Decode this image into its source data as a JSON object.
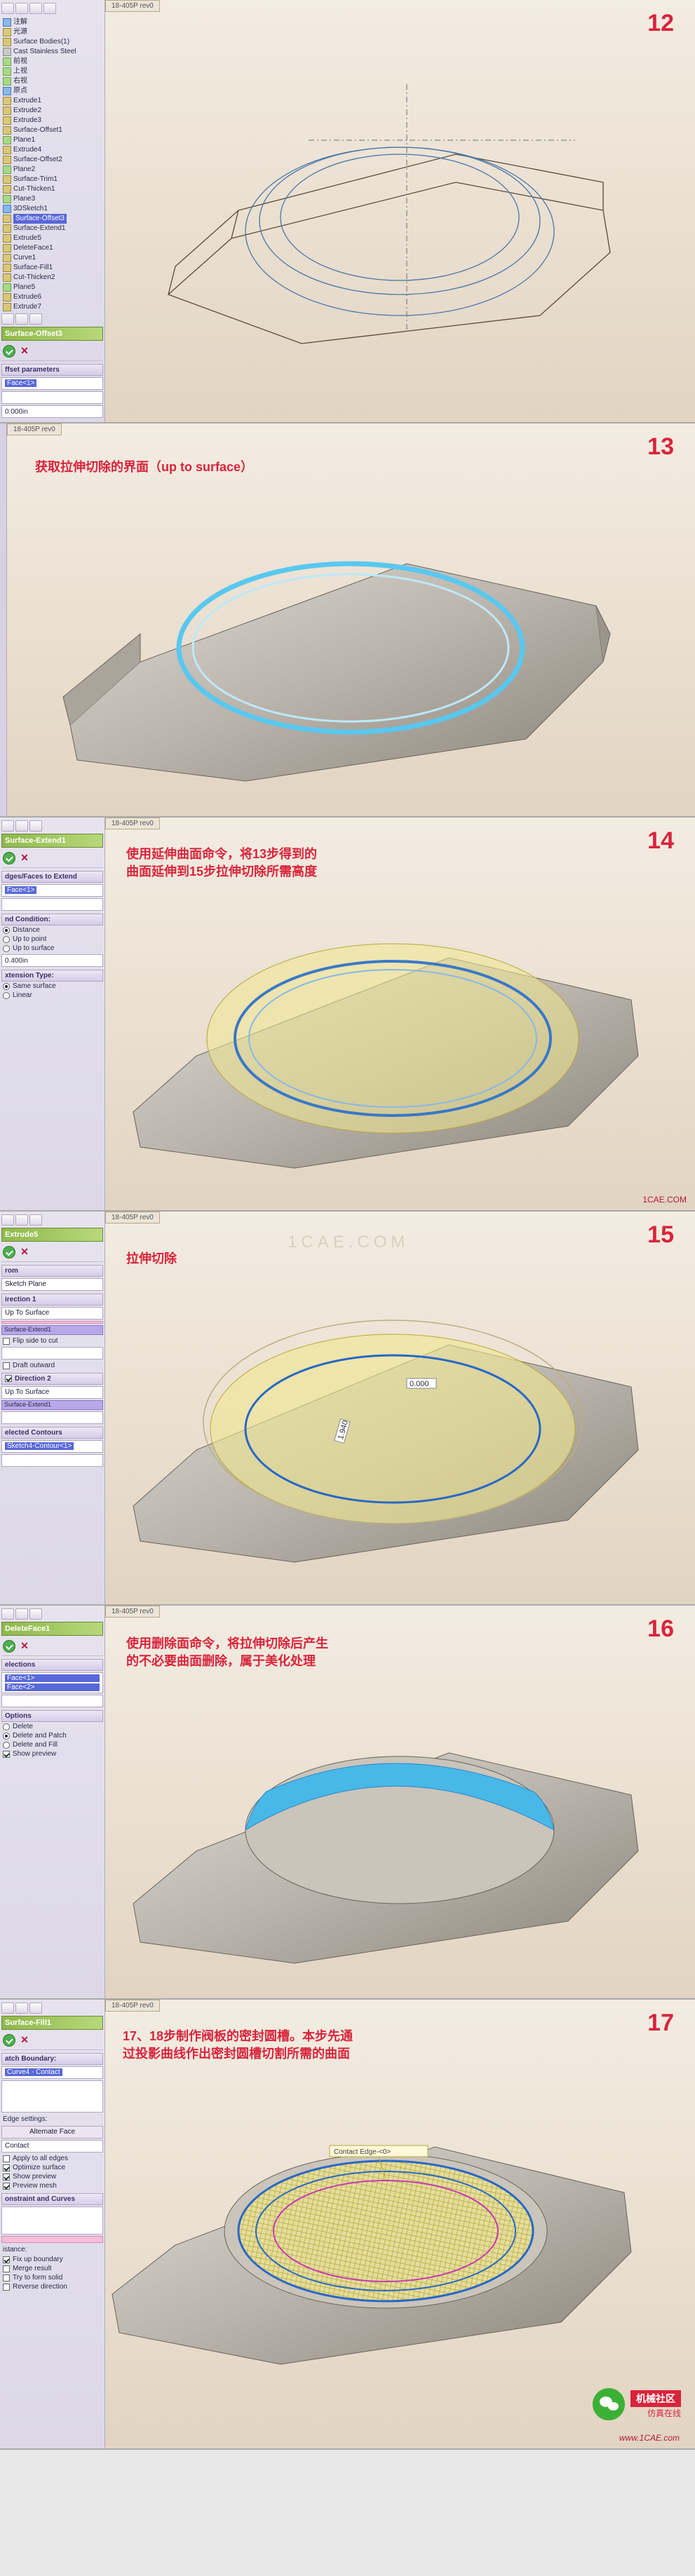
{
  "steps": {
    "12": {
      "num": "12",
      "doc_tab": "18-405P rev0",
      "tree": [
        {
          "icon": "blue",
          "label": "注解"
        },
        {
          "icon": "gold",
          "label": "光源"
        },
        {
          "icon": "gold",
          "label": "Surface Bodies(1)"
        },
        {
          "icon": "gray",
          "label": "Cast Stainless Steel"
        },
        {
          "icon": "green",
          "label": "前视"
        },
        {
          "icon": "green",
          "label": "上视"
        },
        {
          "icon": "green",
          "label": "右视"
        },
        {
          "icon": "blue",
          "label": "原点"
        },
        {
          "icon": "gold",
          "label": "Extrude1"
        },
        {
          "icon": "gold",
          "label": "Extrude2"
        },
        {
          "icon": "gold",
          "label": "Extrude3"
        },
        {
          "icon": "gold",
          "label": "Surface-Offset1"
        },
        {
          "icon": "green",
          "label": "Plane1"
        },
        {
          "icon": "gold",
          "label": "Extrude4"
        },
        {
          "icon": "gold",
          "label": "Surface-Offset2"
        },
        {
          "icon": "green",
          "label": "Plane2"
        },
        {
          "icon": "gold",
          "label": "Surface-Trim1"
        },
        {
          "icon": "gold",
          "label": "Cut-Thicken1"
        },
        {
          "icon": "green",
          "label": "Plane3"
        },
        {
          "icon": "blue",
          "label": "3DSketch1"
        },
        {
          "icon": "gold",
          "label": "Surface-Offset3"
        },
        {
          "icon": "gold",
          "label": "Surface-Extend1"
        },
        {
          "icon": "gold",
          "label": "Extrude5"
        },
        {
          "icon": "gold",
          "label": "DeleteFace1"
        },
        {
          "icon": "gold",
          "label": "Curve1"
        },
        {
          "icon": "gold",
          "label": "Surface-Fill1"
        },
        {
          "icon": "gold",
          "label": "Cut-Thicken2"
        },
        {
          "icon": "green",
          "label": "Plane5"
        },
        {
          "icon": "gold",
          "label": "Extrude6"
        },
        {
          "icon": "gold",
          "label": "Extrude7"
        }
      ],
      "panel_title": "Surface-Offset3",
      "section1": "ffset parameters",
      "field_face": "Face<1>",
      "dim_value": "0.000in"
    },
    "13": {
      "num": "13",
      "doc_tab": "18-405P rev0",
      "annotation": "获取拉伸切除的界面（up to surface）"
    },
    "14": {
      "num": "14",
      "doc_tab": "18-405P rev0",
      "panel_title": "Surface-Extend1",
      "section_edges": "dges/Faces to Extend",
      "field_face": "Face<1>",
      "section_cond": "nd Condition:",
      "radio_distance": "Distance",
      "radio_uptopoint": "Up to point",
      "radio_uptosurf": "Up to surface",
      "dim_value": "0.400in",
      "section_exttype": "xtension Type:",
      "radio_same": "Same surface",
      "radio_linear": "Linear",
      "annotation": "使用延伸曲面命令，将13步得到的\n曲面延伸到15步拉伸切除所需高度"
    },
    "15": {
      "num": "15",
      "doc_tab": "18-405P rev0",
      "panel_title": "Extrude5",
      "section_from": "rom",
      "from_value": "Sketch Plane",
      "section_dir1": "irection 1",
      "dir1_type": "Up To Surface",
      "dir1_face": "Surface-Extend1",
      "check_flip": "Flip side to cut",
      "check_draft": "Draft outward",
      "section_dir2": "Direction 2",
      "dir2_type": "Up To Surface",
      "dir2_face": "Surface-Extend1",
      "section_contours": "elected Contours",
      "contour_value": "Sketch4-Contour<1>",
      "annotation": "拉伸切除",
      "dim1": "0.000",
      "dim2": "1.940"
    },
    "16": {
      "num": "16",
      "doc_tab": "18-405P rev0",
      "panel_title": "DeleteFace1",
      "section_sel": "elections",
      "face1": "Face<1>",
      "face2": "Face<2>",
      "section_opt": "Options",
      "radio_delete": "Delete",
      "radio_delpatch": "Delete and Patch",
      "radio_delfill": "Delete and Fill",
      "check_showprev": "Show preview",
      "annotation": "使用删除面命令，将拉伸切除后产生\n的不必要曲面删除，属于美化处理"
    },
    "17": {
      "num": "17",
      "doc_tab": "18-405P rev0",
      "panel_title": "Surface-Fill1",
      "section_patch": "atch Boundary:",
      "patch_value": "Curve4 - Contact",
      "edge_settings_label": "Edge settings:",
      "alt_face": "Alternate Face",
      "contact_label": "Contact",
      "check_apply": "Apply to all edges",
      "check_optim": "Optimize surface",
      "check_showprev": "Show preview",
      "check_prevmesh": "Preview mesh",
      "section_constraint": "onstraint and Curves",
      "misc_text": "istance:",
      "check_fixup": "Fix up boundary",
      "check_merge": "Merge result",
      "check_trynew": "Try to form solid",
      "check_revdir": "Reverse direction",
      "annotation": "17、18步制作阀板的密封圆槽。本步先通\n过投影曲线作出密封圆槽切割所需的曲面",
      "contact_highlight": "Contact Edge-<0>"
    }
  },
  "watermark": "1CAE.COM",
  "footer": {
    "brand": "机械社区",
    "sub": "仿真在线",
    "url": "www.1CAE.com"
  }
}
